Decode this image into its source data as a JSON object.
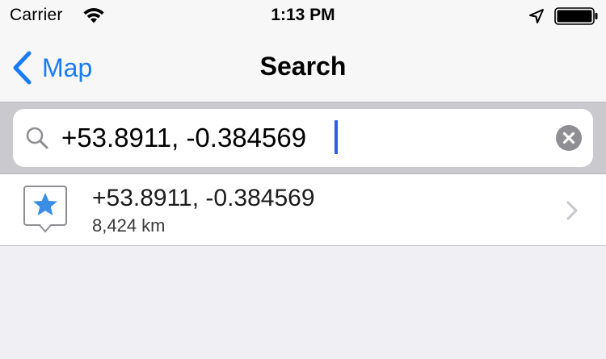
{
  "status_bar": {
    "carrier": "Carrier",
    "time": "1:13 PM",
    "icons": [
      "wifi-icon",
      "location-arrow-icon",
      "battery-icon"
    ]
  },
  "nav": {
    "back_label": "Map",
    "title": "Search",
    "accent_color": "#1a7cf5"
  },
  "search": {
    "value": "+53.8911, -0.384569",
    "icons": [
      "search-icon",
      "clear-icon"
    ]
  },
  "results": [
    {
      "title": "+53.8911, -0.384569",
      "subtitle": "8,424 km",
      "icon": "star-pin-icon",
      "accessory": "chevron-right-icon"
    }
  ],
  "colors": {
    "background": "#efeff4",
    "search_bar_bg": "#c9c9ce",
    "caret": "#2f5bea",
    "star": "#3a8ee6"
  }
}
